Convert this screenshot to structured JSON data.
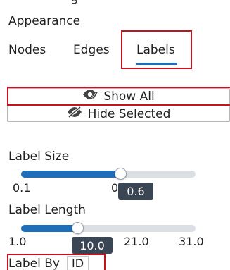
{
  "panel": {
    "title": "Appearance",
    "tabs": [
      {
        "label": "Nodes",
        "active": false
      },
      {
        "label": "Edges",
        "active": false
      },
      {
        "label": "Labels",
        "active": true
      }
    ]
  },
  "buttons": {
    "show_all": "Show All",
    "show_all_icon": "eye-check-icon",
    "hide_selected": "Hide Selected",
    "hide_selected_icon": "eye-slash-icon"
  },
  "label_size": {
    "label": "Label Size",
    "min_label": "0.1",
    "next_tick_label": "0",
    "value": "0.6",
    "fill_fraction": 0.52
  },
  "label_length": {
    "label": "Label Length",
    "ticks": [
      "1.0",
      "21.0",
      "31.0"
    ],
    "value": "10.0",
    "fill_fraction": 0.3
  },
  "label_by": {
    "label": "Label By",
    "value": "ID"
  },
  "colors": {
    "accent": "#1e6fb8",
    "highlight": "#c8101f",
    "tooltip_bg": "#3a4654"
  }
}
